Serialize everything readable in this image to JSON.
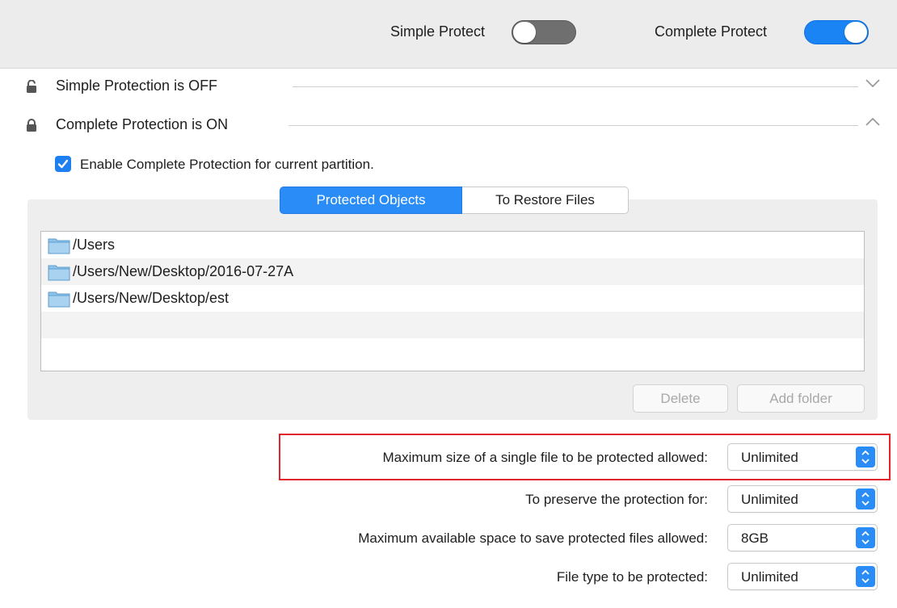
{
  "header": {
    "simple_protect_label": "Simple Protect",
    "simple_protect_on": false,
    "complete_protect_label": "Complete Protect",
    "complete_protect_on": true
  },
  "sections": [
    {
      "title": "Simple Protection is OFF",
      "expanded": false,
      "icon": "unlocked-icon"
    },
    {
      "title": "Complete Protection is ON",
      "expanded": true,
      "icon": "locked-icon"
    }
  ],
  "enable_checkbox": {
    "label": "Enable Complete Protection for current partition.",
    "checked": true
  },
  "tabs": [
    {
      "label": "Protected Objects",
      "active": true
    },
    {
      "label": "To Restore Files",
      "active": false
    }
  ],
  "protected_objects": [
    {
      "path": "/Users",
      "icon": "folder-icon"
    },
    {
      "path": "/Users/New/Desktop/2016-07-27A",
      "icon": "folder-icon"
    },
    {
      "path": "/Users/New/Desktop/est",
      "icon": "folder-icon"
    }
  ],
  "buttons": {
    "delete_label": "Delete",
    "add_folder_label": "Add folder"
  },
  "settings": [
    {
      "label": "Maximum size of a single file to be protected allowed:",
      "value": "Unlimited",
      "highlighted": true
    },
    {
      "label": "To preserve the protection for:",
      "value": "Unlimited",
      "highlighted": false
    },
    {
      "label": "Maximum available space to save protected files allowed:",
      "value": "8GB",
      "highlighted": false
    },
    {
      "label": "File type to be protected:",
      "value": "Unlimited",
      "highlighted": false
    }
  ],
  "colors": {
    "accent": "#1a84f5",
    "highlight_border": "#e0262b",
    "toggle_off": "#6f6f6f"
  }
}
